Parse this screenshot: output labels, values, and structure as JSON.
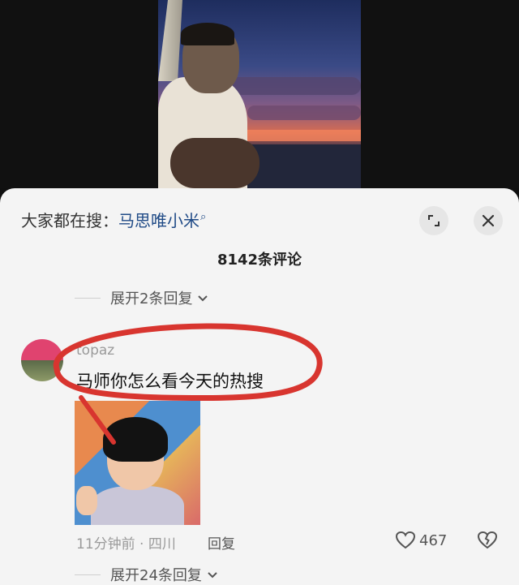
{
  "sheet": {
    "search_prefix": "大家都在搜：",
    "search_term": "马思唯小米",
    "search_icon": "search-icon",
    "title": "8142条评论",
    "expand_top": "展开2条回复",
    "expand_bottom": "展开24条回复"
  },
  "comment": {
    "username": "topaz",
    "text": "马师你怎么看今天的热搜",
    "time_location": "11分钟前 · 四川",
    "reply_label": "回复",
    "like_count": "467"
  },
  "colors": {
    "link": "#1f4a86",
    "annotation_red": "#d8352f",
    "sheet_bg": "#f4f4f4"
  }
}
